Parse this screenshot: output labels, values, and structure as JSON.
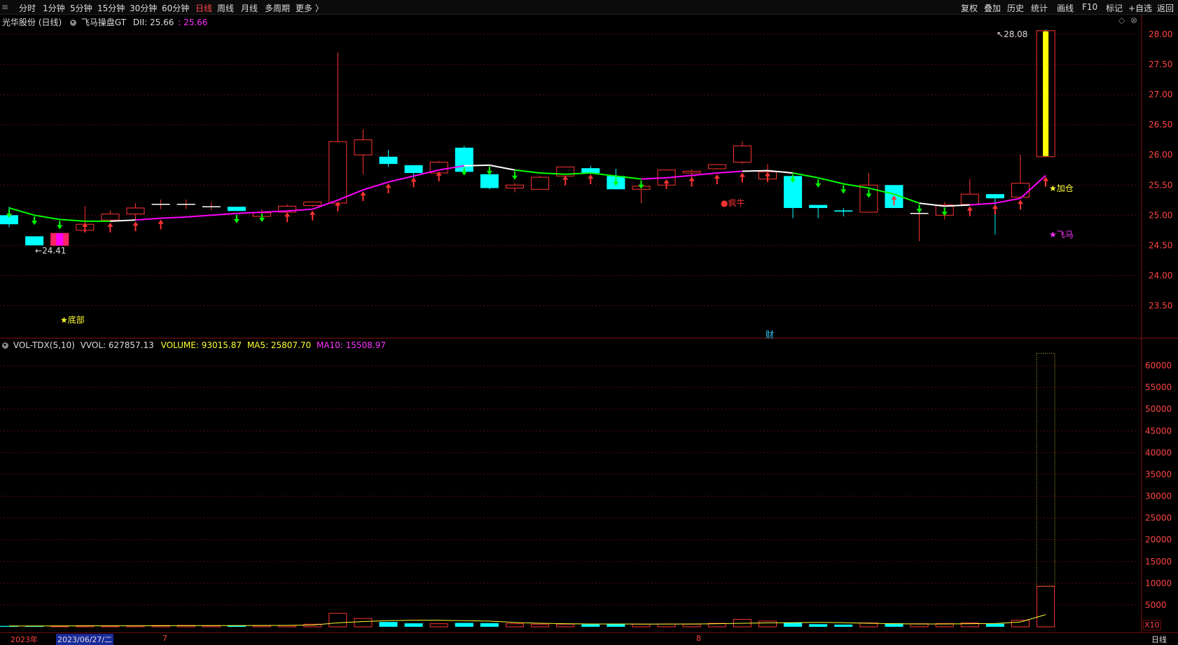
{
  "toolbar": {
    "periods": [
      "分时",
      "1分钟",
      "5分钟",
      "15分钟",
      "30分钟",
      "60分钟",
      "日线",
      "周线",
      "月线",
      "多周期",
      "更多 〉"
    ],
    "active_period": "日线",
    "right_buttons": [
      "复权",
      "叠加",
      "历史",
      "统计",
      "画线",
      "F10",
      "标记",
      "+自选",
      "返回"
    ]
  },
  "main_header": {
    "stock_name": "光华股份 (日线)",
    "indicator": "飞马操盘GT",
    "dii_label": "DII: 25.66",
    "dii_value": ": 25.66"
  },
  "vol_header": {
    "indicator": "VOL-TDX(5,10)",
    "vvol": "VVOL: 627857.13",
    "volume": "VOLUME: 93015.87",
    "ma5": "MA5: 25807.70",
    "ma10": "MA10: 15508.97"
  },
  "annotations": {
    "high_label": "28.08",
    "low_label": "24.41",
    "bottom_signal": "★底部",
    "add_signal": "★加仓",
    "feima_signal": "★飞马",
    "crazy_bull": "●疯牛",
    "finance_marker": "财"
  },
  "bottom_bar": {
    "year": "2023年",
    "selected_date": "2023/06/27/二",
    "month_7": "7",
    "month_8": "8",
    "period": "日线",
    "vol_multiplier": "X10"
  },
  "colors": {
    "up": "#ff3333",
    "down": "#00ffff",
    "ma_up": "#ff00ff",
    "ma_down": "#00ff00",
    "ma_flat": "#ffffff",
    "limit_up": "#ffff00",
    "grid": "#5a0a0a"
  },
  "chart_data": {
    "type": "candlestick",
    "price_ticks": [
      "28.00",
      "27.50",
      "27.00",
      "26.50",
      "26.00",
      "25.50",
      "25.00",
      "24.50",
      "24.00",
      "23.50"
    ],
    "volume_ticks": [
      "60000",
      "55000",
      "50000",
      "45000",
      "40000",
      "35000",
      "30000",
      "25000",
      "20000",
      "15000",
      "10000",
      "5000"
    ],
    "candles": [
      {
        "o": 25.0,
        "h": 25.14,
        "l": 24.8,
        "c": 24.85
      },
      {
        "o": 24.65,
        "h": 24.65,
        "l": 24.5,
        "c": 24.5
      },
      {
        "o": 24.5,
        "h": 24.7,
        "l": 24.5,
        "c": 24.7
      },
      {
        "o": 24.75,
        "h": 25.15,
        "l": 24.75,
        "c": 24.85
      },
      {
        "o": 24.92,
        "h": 25.08,
        "l": 24.9,
        "c": 25.02
      },
      {
        "o": 25.02,
        "h": 25.2,
        "l": 24.92,
        "c": 25.12
      },
      {
        "o": 25.18,
        "h": 25.26,
        "l": 25.1,
        "c": 25.18
      },
      {
        "o": 25.18,
        "h": 25.26,
        "l": 25.1,
        "c": 25.18
      },
      {
        "o": 25.14,
        "h": 25.22,
        "l": 25.08,
        "c": 25.14
      },
      {
        "o": 25.14,
        "h": 25.14,
        "l": 25.07,
        "c": 25.07
      },
      {
        "o": 24.98,
        "h": 25.1,
        "l": 24.92,
        "c": 25.04
      },
      {
        "o": 25.05,
        "h": 25.18,
        "l": 25.02,
        "c": 25.15
      },
      {
        "o": 25.16,
        "h": 25.22,
        "l": 25.14,
        "c": 25.22
      },
      {
        "o": 25.2,
        "h": 27.7,
        "l": 25.17,
        "c": 26.22
      },
      {
        "o": 26.0,
        "h": 26.42,
        "l": 25.68,
        "c": 26.25
      },
      {
        "o": 25.97,
        "h": 26.08,
        "l": 25.8,
        "c": 25.85
      },
      {
        "o": 25.83,
        "h": 25.83,
        "l": 25.5,
        "c": 25.7
      },
      {
        "o": 25.7,
        "h": 25.9,
        "l": 25.62,
        "c": 25.88
      },
      {
        "o": 26.12,
        "h": 26.15,
        "l": 25.72,
        "c": 25.72
      },
      {
        "o": 25.68,
        "h": 25.68,
        "l": 25.43,
        "c": 25.45
      },
      {
        "o": 25.45,
        "h": 25.53,
        "l": 25.38,
        "c": 25.5
      },
      {
        "o": 25.43,
        "h": 25.65,
        "l": 25.43,
        "c": 25.63
      },
      {
        "o": 25.65,
        "h": 25.8,
        "l": 25.63,
        "c": 25.8
      },
      {
        "o": 25.78,
        "h": 25.82,
        "l": 25.68,
        "c": 25.7
      },
      {
        "o": 25.65,
        "h": 25.77,
        "l": 25.43,
        "c": 25.43
      },
      {
        "o": 25.43,
        "h": 25.55,
        "l": 25.2,
        "c": 25.48
      },
      {
        "o": 25.5,
        "h": 25.75,
        "l": 25.5,
        "c": 25.75
      },
      {
        "o": 25.7,
        "h": 25.76,
        "l": 25.55,
        "c": 25.73
      },
      {
        "o": 25.77,
        "h": 25.84,
        "l": 25.77,
        "c": 25.84
      },
      {
        "o": 25.88,
        "h": 26.22,
        "l": 25.85,
        "c": 26.15
      },
      {
        "o": 25.6,
        "h": 25.85,
        "l": 25.55,
        "c": 25.72
      },
      {
        "o": 25.65,
        "h": 25.65,
        "l": 24.95,
        "c": 25.12
      },
      {
        "o": 25.17,
        "h": 25.17,
        "l": 24.95,
        "c": 25.12
      },
      {
        "o": 25.08,
        "h": 25.12,
        "l": 24.98,
        "c": 25.06
      },
      {
        "o": 25.05,
        "h": 25.7,
        "l": 25.05,
        "c": 25.5
      },
      {
        "o": 25.5,
        "h": 25.5,
        "l": 25.12,
        "c": 25.12
      },
      {
        "o": 25.03,
        "h": 25.12,
        "l": 24.57,
        "c": 25.03
      },
      {
        "o": 25.0,
        "h": 25.22,
        "l": 24.93,
        "c": 25.17
      },
      {
        "o": 25.18,
        "h": 25.6,
        "l": 25.18,
        "c": 25.35
      },
      {
        "o": 25.35,
        "h": 25.35,
        "l": 24.68,
        "c": 25.28
      },
      {
        "o": 25.3,
        "h": 26.0,
        "l": 25.3,
        "c": 25.53
      },
      {
        "o": 25.97,
        "h": 28.08,
        "l": 25.97,
        "c": 28.06
      }
    ],
    "line": [
      25.12,
      25.0,
      24.93,
      24.9,
      24.9,
      24.92,
      24.95,
      24.97,
      25.0,
      25.03,
      25.05,
      25.07,
      25.1,
      25.25,
      25.42,
      25.55,
      25.65,
      25.75,
      25.82,
      25.83,
      25.75,
      25.7,
      25.68,
      25.7,
      25.65,
      25.6,
      25.62,
      25.66,
      25.7,
      25.73,
      25.74,
      25.7,
      25.62,
      25.52,
      25.45,
      25.35,
      25.2,
      25.15,
      25.17,
      25.2,
      25.28,
      25.66
    ],
    "line_colors": [
      "g",
      "g",
      "g",
      "g",
      "g",
      "w",
      "m",
      "m",
      "m",
      "m",
      "m",
      "m",
      "m",
      "m",
      "m",
      "m",
      "m",
      "m",
      "m",
      "w",
      "w",
      "g",
      "g",
      "g",
      "g",
      "g",
      "m",
      "m",
      "m",
      "m",
      "w",
      "w",
      "g",
      "g",
      "g",
      "g",
      "g",
      "w",
      "w",
      "m",
      "m",
      "m"
    ],
    "arrows": [
      "d",
      "d",
      "d",
      "u",
      "u",
      "u",
      "u",
      "",
      "",
      "d",
      "d",
      "u",
      "u",
      "u",
      "u",
      "u",
      "u",
      "u",
      "d",
      "d",
      "d",
      "",
      "u",
      "u",
      "d",
      "d",
      "u",
      "u",
      "u",
      "u",
      "u",
      "d",
      "d",
      "d",
      "d",
      "u",
      "d",
      "d",
      "u",
      "u",
      "u",
      "u"
    ],
    "volume": [
      200,
      180,
      170,
      260,
      200,
      240,
      300,
      320,
      250,
      250,
      280,
      300,
      600,
      3100,
      1900,
      1100,
      800,
      700,
      900,
      850,
      700,
      600,
      600,
      550,
      700,
      600,
      650,
      600,
      800,
      1700,
      1300,
      900,
      600,
      500,
      900,
      800,
      700,
      750,
      900,
      700,
      1500,
      9300
    ],
    "vol_ma5": [
      180,
      190,
      200,
      210,
      220,
      230,
      250,
      260,
      280,
      290,
      300,
      320,
      400,
      900,
      1200,
      1400,
      1500,
      1500,
      1400,
      1300,
      1000,
      800,
      700,
      650,
      650,
      620,
      630,
      650,
      700,
      800,
      900,
      950,
      1000,
      950,
      800,
      700,
      650,
      650,
      700,
      750,
      1100,
      2800
    ]
  }
}
